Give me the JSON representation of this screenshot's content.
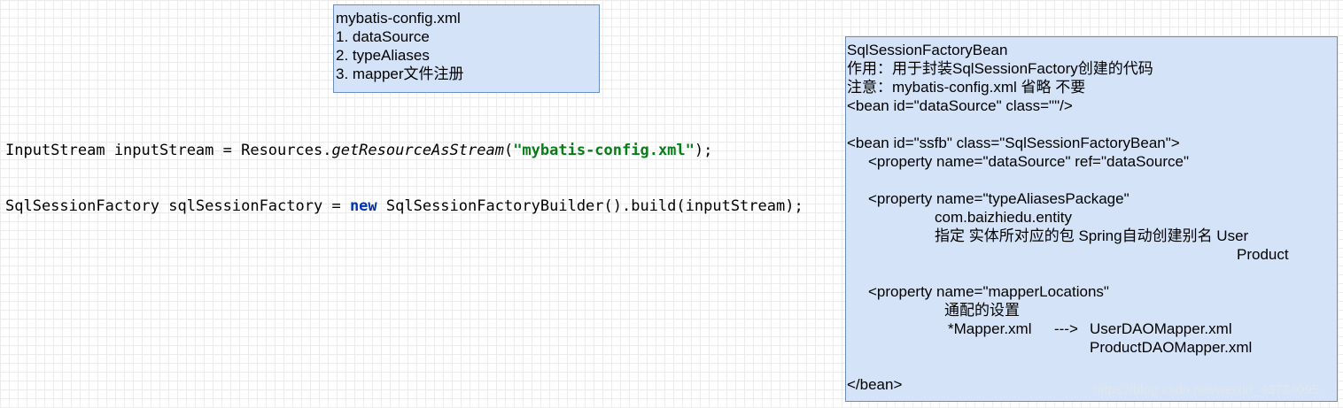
{
  "config_note": {
    "lines": [
      "mybatis-config.xml",
      "1. dataSource",
      "2. typeAliases",
      "3. mapper文件注册"
    ]
  },
  "code": {
    "line1": {
      "a": "InputStream inputStream = Resources.",
      "method": "getResourceAsStream",
      "b": "(",
      "str": "\"mybatis-config.xml\"",
      "c": ");"
    },
    "line2": {
      "a": "SqlSessionFactory sqlSessionFactory = ",
      "kw": "new",
      "b": " SqlSessionFactoryBuilder().build(inputStream);"
    }
  },
  "bean_note": {
    "lines": [
      "SqlSessionFactoryBean",
      "作用：用于封装SqlSessionFactory创建的代码",
      "注意：mybatis-config.xml 省略 不要",
      "<bean id=\"dataSource\" class=\"\"/>",
      "<bean id=\"ssfb\" class=\"SqlSessionFactoryBean\">",
      "<property name=\"dataSource\" ref=\"dataSource\"",
      "<property name=\"typeAliasesPackage\"",
      "com.baizhiedu.entity",
      "指定 实体所对应的包 Spring自动创建别名 User",
      "Product",
      "<property name=\"mapperLocations\"",
      "通配的设置",
      "*Mapper.xml",
      "--->",
      "UserDAOMapper.xml",
      "ProductDAOMapper.xml",
      "</bean>"
    ]
  },
  "watermark": "https://blog.csdn.net/weixin_43734095"
}
